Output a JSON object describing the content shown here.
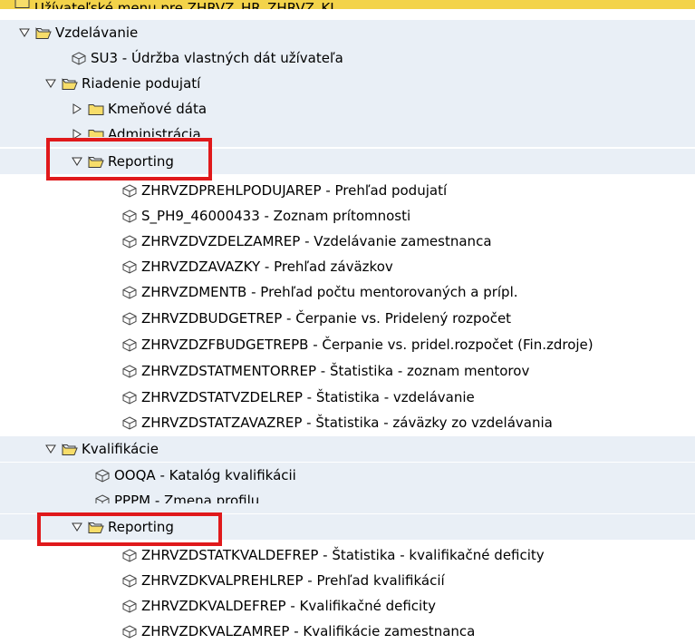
{
  "tree": {
    "top_label": "Užívateľské menu pre ZHRVZ_HR_ZHRVZ_KL",
    "items": [
      {
        "label": "Vzdelávanie",
        "type": "folder-open",
        "level": 1
      },
      {
        "label": "SU3 - Údržba vlastných dát užívateľa",
        "type": "transaction",
        "level": 3
      },
      {
        "label": "Riadenie podujatí",
        "type": "folder-open",
        "level": 2
      },
      {
        "label": "Kmeňové dáta",
        "type": "folder-closed",
        "level": 3
      },
      {
        "label": "Administrácia",
        "type": "folder-closed",
        "level": 3
      },
      {
        "label": "Reporting",
        "type": "folder-open",
        "level": 3
      },
      {
        "label": "ZHRVZDPREHLPODUJAREP - Prehľad podujatí",
        "type": "transaction",
        "level": 5
      },
      {
        "label": "S_PH9_46000433 - Zoznam prítomnosti",
        "type": "transaction",
        "level": 5
      },
      {
        "label": "ZHRVZDVZDELZAMREP - Vzdelávanie zamestnanca",
        "type": "transaction",
        "level": 5
      },
      {
        "label": "ZHRVZDZAVAZKY - Prehľad záväzkov",
        "type": "transaction",
        "level": 5
      },
      {
        "label": "ZHRVZDMENTB - Prehľad počtu mentorovaných a prípl.",
        "type": "transaction",
        "level": 5
      },
      {
        "label": "ZHRVZDBUDGETREP - Čerpanie vs. Pridelený rozpočet",
        "type": "transaction",
        "level": 5
      },
      {
        "label": "ZHRVZDZFBUDGETREPB - Čerpanie vs. pridel.rozpočet (Fin.zdroje)",
        "type": "transaction",
        "level": 5
      },
      {
        "label": "ZHRVZDSTATMENTORREP - Štatistika - zoznam mentorov",
        "type": "transaction",
        "level": 5
      },
      {
        "label": "ZHRVZDSTATVZDELREP - Štatistika - vzdelávanie",
        "type": "transaction",
        "level": 5
      },
      {
        "label": "ZHRVZDSTATZAVAZREP - Štatistika - záväzky zo vzdelávania",
        "type": "transaction",
        "level": 5
      },
      {
        "label": "Kvalifikácie",
        "type": "folder-open",
        "level": 2
      },
      {
        "label": "OOQA - Katalóg kvalifikácii",
        "type": "transaction",
        "level": 4
      },
      {
        "label": "PPPM - Zmena profilu",
        "type": "transaction",
        "level": 4
      },
      {
        "label": "Reporting",
        "type": "folder-open",
        "level": 3
      },
      {
        "label": "ZHRVZDSTATKVALDEFREP - Štatistika - kvalifikačné deficity",
        "type": "transaction",
        "level": 5
      },
      {
        "label": "ZHRVZDKVALPREHLREP - Prehľad kvalifikácií",
        "type": "transaction",
        "level": 5
      },
      {
        "label": "ZHRVZDKVALDEFREP - Kvalifikačné deficity",
        "type": "transaction",
        "level": 5
      },
      {
        "label": "ZHRVZDKVALZAMREP - Kvalifikácie zamestnanca",
        "type": "transaction",
        "level": 5
      }
    ]
  },
  "colors": {
    "selected_row": "#f3d34a",
    "alt_row": "#e9eff6",
    "highlight_box": "#e0191b",
    "folder_fill": "#f7dd6a",
    "folder_stroke": "#3b3b3b"
  }
}
